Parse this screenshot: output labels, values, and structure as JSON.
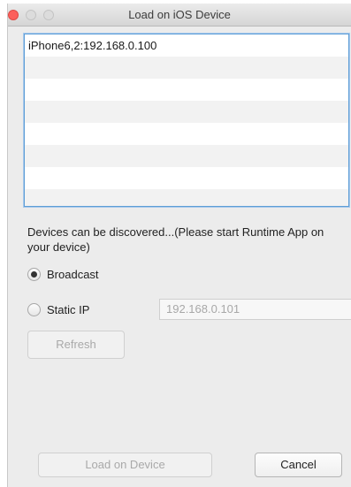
{
  "window": {
    "title": "Load on iOS Device"
  },
  "devices": [
    "iPhone6,2:192.168.0.100",
    "",
    "",
    "",
    "",
    "",
    "",
    ""
  ],
  "description": "Devices can be discovered...(Please start Runtime App on your device)",
  "options": {
    "broadcast_label": "Broadcast",
    "static_ip_label": "Static IP",
    "selected": "Broadcast",
    "ip_value": "192.168.0.101"
  },
  "buttons": {
    "refresh": "Refresh",
    "load": "Load on Device",
    "cancel": "Cancel"
  },
  "colors": {
    "close": "#fc605c",
    "list_border": "#5e9ed6"
  }
}
